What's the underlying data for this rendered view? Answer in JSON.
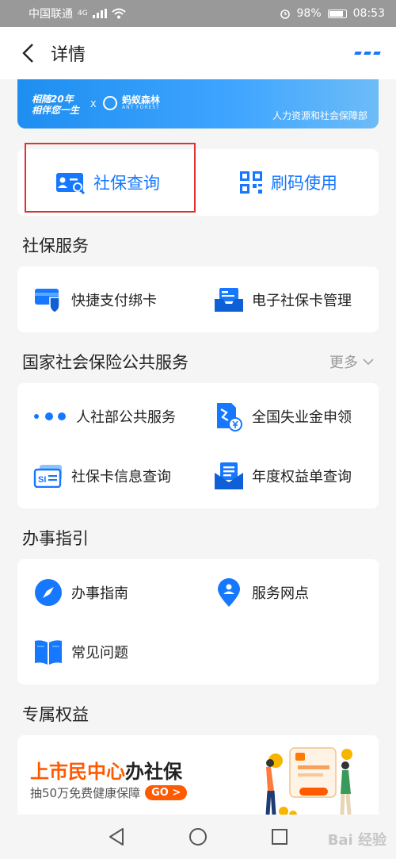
{
  "status_bar": {
    "carrier": "中国联通",
    "network": "4G",
    "battery": "98%",
    "time": "08:53"
  },
  "nav": {
    "title": "详情"
  },
  "banner": {
    "slogan_line1": "相随20年",
    "slogan_line2": "相伴您一生",
    "x": "X",
    "partner_name": "蚂蚁森林",
    "partner_sub": "ANT FOREST",
    "dept": "人力资源和社会保障部"
  },
  "quick_actions": [
    {
      "label": "社保查询",
      "icon": "id-card-search-icon"
    },
    {
      "label": "刷码使用",
      "icon": "qr-code-icon"
    }
  ],
  "sections": {
    "social_security": {
      "title": "社保服务",
      "items": [
        {
          "label": "快捷支付绑卡",
          "icon": "card-shield-icon"
        },
        {
          "label": "电子社保卡管理",
          "icon": "card-tray-icon"
        }
      ]
    },
    "national": {
      "title": "国家社会保险公共服务",
      "more": "更多",
      "items": [
        {
          "label": "人社部公共服务",
          "icon": "three-dots-icon"
        },
        {
          "label": "全国失业金申领",
          "icon": "document-yuan-icon"
        },
        {
          "label": "社保卡信息查询",
          "icon": "si-card-icon"
        },
        {
          "label": "年度权益单查询",
          "icon": "envelope-list-icon"
        }
      ]
    },
    "guide": {
      "title": "办事指引",
      "items": [
        {
          "label": "办事指南",
          "icon": "compass-icon"
        },
        {
          "label": "服务网点",
          "icon": "location-pin-icon"
        },
        {
          "label": "常见问题",
          "icon": "book-icon"
        }
      ]
    },
    "benefits": {
      "title": "专属权益",
      "promo_title_highlight": "上市民中心",
      "promo_title_rest": "办社保",
      "promo_sub": "抽50万免费健康保障",
      "promo_go": "GO >"
    }
  },
  "colors": {
    "accent": "#1677ff",
    "promo": "#ff5a00",
    "highlight_box": "#dd3333"
  }
}
